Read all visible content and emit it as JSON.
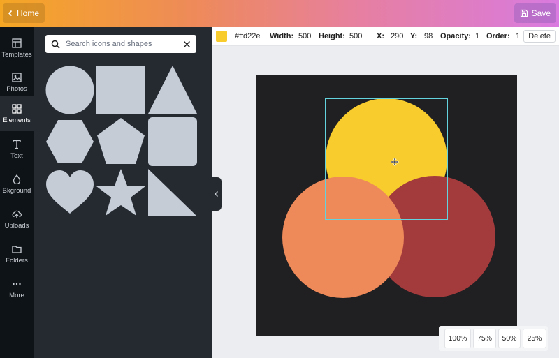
{
  "header": {
    "home_label": "Home",
    "save_label": "Save"
  },
  "rail": [
    {
      "label": "Templates",
      "icon": "templates-icon"
    },
    {
      "label": "Photos",
      "icon": "photos-icon"
    },
    {
      "label": "Elements",
      "icon": "elements-icon",
      "active": true
    },
    {
      "label": "Text",
      "icon": "text-icon"
    },
    {
      "label": "Bkground",
      "icon": "background-icon"
    },
    {
      "label": "Uploads",
      "icon": "uploads-icon"
    },
    {
      "label": "Folders",
      "icon": "folders-icon"
    },
    {
      "label": "More",
      "icon": "more-icon"
    }
  ],
  "search": {
    "placeholder": "Search icons and shapes"
  },
  "shapes": [
    "circle",
    "square",
    "triangle",
    "hexagon",
    "pentagon",
    "rounded-square",
    "heart",
    "star",
    "right-triangle"
  ],
  "toolbar": {
    "color_value": "#ffd22e",
    "width_label": "Width:",
    "width_value": "500",
    "height_label": "Height:",
    "height_value": "500",
    "x_label": "X:",
    "x_value": "290",
    "y_label": "Y:",
    "y_value": "98",
    "opacity_label": "Opacity:",
    "opacity_value": "1",
    "order_label": "Order:",
    "order_value": "1",
    "delete_label": "Delete"
  },
  "colors": {
    "yellow_circle": "#f8cc2d",
    "orange_circle": "#ee895a",
    "red_circle": "#a33b3c",
    "canvas_bg": "#201f22",
    "shape_fill": "#c5ccd6"
  },
  "zoom": [
    "100%",
    "75%",
    "50%",
    "25%"
  ]
}
